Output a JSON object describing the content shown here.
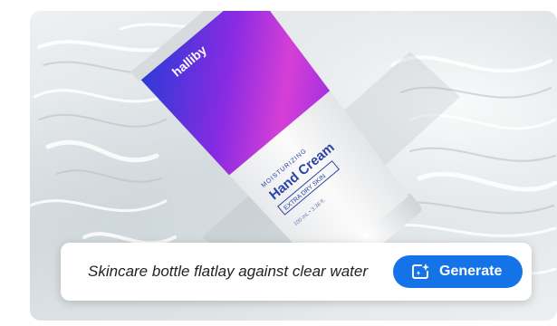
{
  "product": {
    "brand": "halliby",
    "subtitle": "MOISTURIZING",
    "name": "Hand Cream",
    "tag": "EXTRA DRY SKIN",
    "volume": "100 mL • 3.38 fl."
  },
  "prompt": {
    "text": "Skincare bottle flatlay against clear water"
  },
  "generate_button": {
    "label": "Generate",
    "icon": "sparkle-frame-icon"
  },
  "colors": {
    "accent": "#1473e6",
    "tube_purple": "#8a2be2",
    "tube_magenta": "#d63fd6"
  }
}
